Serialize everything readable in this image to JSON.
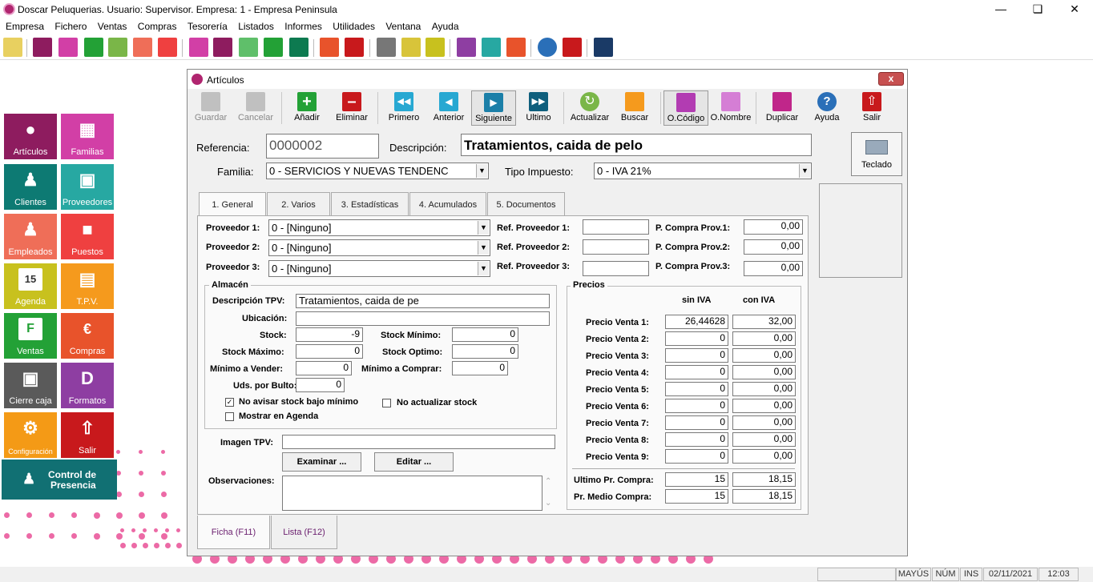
{
  "app": {
    "title": "Doscar Peluquerias. Usuario: Supervisor. Empresa: 1 - Empresa Peninsula"
  },
  "menu": [
    "Empresa",
    "Fichero",
    "Ventas",
    "Compras",
    "Tesorería",
    "Listados",
    "Informes",
    "Utilidades",
    "Ventana",
    "Ayuda"
  ],
  "tiles": [
    {
      "label": "Artículos",
      "color": "#8e1c5f"
    },
    {
      "label": "Familias",
      "color": "#d23fa6"
    },
    {
      "label": "Clientes",
      "color": "#0d7a73"
    },
    {
      "label": "Proveedores",
      "color": "#27a8a2"
    },
    {
      "label": "Empleados",
      "color": "#ef6e58"
    },
    {
      "label": "Puestos",
      "color": "#ef4040"
    },
    {
      "label": "Agenda",
      "color": "#c8c11e"
    },
    {
      "label": "T.P.V.",
      "color": "#f59a1d"
    },
    {
      "label": "Ventas",
      "color": "#23a136"
    },
    {
      "label": "Compras",
      "color": "#e8532b"
    },
    {
      "label": "Cierre caja",
      "color": "#5a5a5a"
    },
    {
      "label": "Formatos",
      "color": "#8e3ea2"
    },
    {
      "label": "Configuración",
      "color": "#f49a16"
    },
    {
      "label": "Salir",
      "color": "#c8191c"
    }
  ],
  "presencia": {
    "line1": "Control de",
    "line2": "Presencia"
  },
  "window": {
    "title": "Artículos",
    "close": "x",
    "toolbar": [
      {
        "label": "Guardar",
        "enabled": false
      },
      {
        "label": "Cancelar",
        "enabled": false
      },
      {
        "label": "Añadir"
      },
      {
        "label": "Eliminar"
      },
      {
        "label": "Primero"
      },
      {
        "label": "Anterior"
      },
      {
        "label": "Siguiente"
      },
      {
        "label": "Ultimo"
      },
      {
        "label": "Actualizar"
      },
      {
        "label": "Buscar"
      },
      {
        "label": "O.Código"
      },
      {
        "label": "O.Nombre"
      },
      {
        "label": "Duplicar"
      },
      {
        "label": "Ayuda"
      },
      {
        "label": "Salir"
      }
    ],
    "referencia_label": "Referencia:",
    "referencia": "0000002",
    "descripcion_label": "Descripción:",
    "descripcion": "Tratamientos, caida de pelo",
    "familia_label": "Familia:",
    "familia": "0 - SERVICIOS Y NUEVAS TENDENC",
    "tipo_impuesto_label": "Tipo Impuesto:",
    "tipo_impuesto": "0 - IVA 21%",
    "teclado": "Teclado",
    "tabs": [
      "1. General",
      "2. Varios",
      "3. Estadísticas",
      "4. Acumulados",
      "5. Documentos"
    ],
    "proveedores": [
      {
        "label": "Proveedor 1:",
        "value": "0 - [Ninguno]",
        "ref_label": "Ref. Proveedor 1:",
        "ref": "",
        "pc_label": "P. Compra Prov.1:",
        "pc": "0,00"
      },
      {
        "label": "Proveedor 2:",
        "value": "0 - [Ninguno]",
        "ref_label": "Ref. Proveedor 2:",
        "ref": "",
        "pc_label": "P. Compra Prov.2:",
        "pc": "0,00"
      },
      {
        "label": "Proveedor 3:",
        "value": "0 - [Ninguno]",
        "ref_label": "Ref. Proveedor 3:",
        "ref": "",
        "pc_label": "P. Compra Prov.3:",
        "pc": "0,00"
      }
    ],
    "almacen": {
      "title": "Almacén",
      "desc_tpv_label": "Descripción TPV:",
      "desc_tpv": "Tratamientos, caida de pe",
      "ubicacion_label": "Ubicación:",
      "ubicacion": "",
      "stock_label": "Stock:",
      "stock": "-9",
      "stock_min_label": "Stock Mínimo:",
      "stock_min": "0",
      "stock_max_label": "Stock Máximo:",
      "stock_max": "0",
      "stock_opt_label": "Stock Optimo:",
      "stock_opt": "0",
      "min_vender_label": "Mínimo a Vender:",
      "min_vender": "0",
      "min_comprar_label": "Mínimo a Comprar:",
      "min_comprar": "0",
      "uds_bulto_label": "Uds. por Bulto:",
      "uds_bulto": "0",
      "no_avisar_label": "No avisar stock bajo mínimo",
      "no_avisar": true,
      "no_actualizar_label": "No actualizar stock",
      "no_actualizar": false,
      "mostrar_agenda_label": "Mostrar en Agenda",
      "mostrar_agenda": false
    },
    "imagen_tpv_label": "Imagen TPV:",
    "imagen_tpv": "",
    "examinar": "Examinar ...",
    "editar": "Editar ...",
    "observaciones_label": "Observaciones:",
    "precios": {
      "title": "Precios",
      "sin_iva": "sin IVA",
      "con_iva": "con IVA",
      "rows": [
        {
          "label": "Precio Venta 1:",
          "sin": "26,44628",
          "con": "32,00"
        },
        {
          "label": "Precio Venta 2:",
          "sin": "0",
          "con": "0,00"
        },
        {
          "label": "Precio Venta 3:",
          "sin": "0",
          "con": "0,00"
        },
        {
          "label": "Precio Venta 4:",
          "sin": "0",
          "con": "0,00"
        },
        {
          "label": "Precio Venta 5:",
          "sin": "0",
          "con": "0,00"
        },
        {
          "label": "Precio Venta 6:",
          "sin": "0",
          "con": "0,00"
        },
        {
          "label": "Precio Venta 7:",
          "sin": "0",
          "con": "0,00"
        },
        {
          "label": "Precio Venta 8:",
          "sin": "0",
          "con": "0,00"
        },
        {
          "label": "Precio Venta 9:",
          "sin": "0",
          "con": "0,00"
        }
      ],
      "ultimo_label": "Ultimo Pr. Compra:",
      "ultimo_sin": "15",
      "ultimo_con": "18,15",
      "medio_label": "Pr. Medio Compra:",
      "medio_sin": "15",
      "medio_con": "18,15"
    },
    "bottom_tabs": [
      "Ficha (F11)",
      "Lista (F12)"
    ]
  },
  "status": {
    "mayus": "MAYÚS",
    "num": "NÚM",
    "ins": "INS",
    "date": "02/11/2021",
    "time": "12:03"
  }
}
